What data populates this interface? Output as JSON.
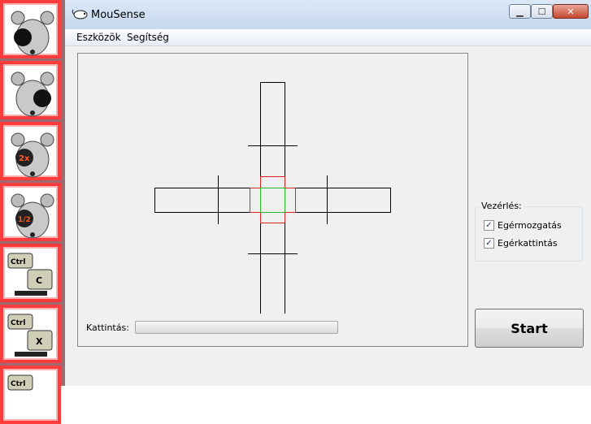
{
  "window": {
    "title": "MouSense"
  },
  "title_controls": {
    "minimize": "▁",
    "maximize": "☐",
    "close": "✕"
  },
  "menu": [
    "Eszközök",
    "Segítség"
  ],
  "toolbar_tiles": [
    {
      "icon": "mouse-left-click-icon"
    },
    {
      "icon": "mouse-right-click-icon"
    },
    {
      "icon": "mouse-double-click-icon",
      "label": "2x"
    },
    {
      "icon": "mouse-half-click-icon",
      "label": "1/2"
    },
    {
      "icon": "ctrl-c-icon",
      "keys": [
        "Ctrl",
        "C"
      ]
    },
    {
      "icon": "ctrl-x-icon",
      "keys": [
        "Ctrl",
        "X"
      ]
    },
    {
      "icon": "ctrl-v-icon",
      "keys": [
        "Ctrl"
      ]
    }
  ],
  "click": {
    "label": "Kattintás:",
    "progress": 0
  },
  "control": {
    "legend": "Vezérlés:",
    "options": [
      {
        "label": "Egérmozgatás",
        "checked": true
      },
      {
        "label": "Egérkattintás",
        "checked": true
      }
    ]
  },
  "start": {
    "label": "Start"
  },
  "colors": {
    "tile_border": "#ff3b3b",
    "center_marker": "#22bb22",
    "zone_marker": "#dd2222"
  }
}
